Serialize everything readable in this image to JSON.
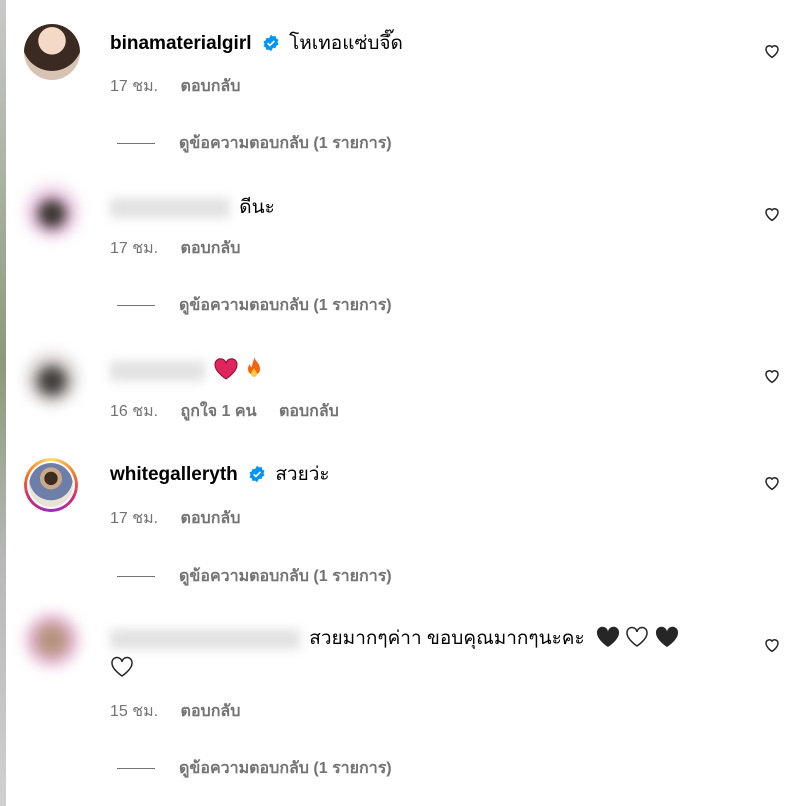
{
  "comments": [
    {
      "username": "binamaterialgirl",
      "text": "โหเทอแซ่บจึ๊ด",
      "time": "17 ชม.",
      "reply": "ตอบกลับ",
      "view_replies": "ดูข้อความตอบกลับ (1 รายการ)"
    },
    {
      "text": "ดีนะ",
      "time": "17 ชม.",
      "reply": "ตอบกลับ",
      "view_replies": "ดูข้อความตอบกลับ (1 รายการ)"
    },
    {
      "time": "16 ชม.",
      "likes": "ถูกใจ 1 คน",
      "reply": "ตอบกลับ"
    },
    {
      "username": "whitegalleryth",
      "text": "สวยว่ะ",
      "time": "17 ชม.",
      "reply": "ตอบกลับ",
      "view_replies": "ดูข้อความตอบกลับ (1 รายการ)"
    },
    {
      "text": "สวยมากๆค่าา ขอบคุณมากๆนะคะ",
      "time": "15 ชม.",
      "reply": "ตอบกลับ",
      "view_replies": "ดูข้อความตอบกลับ (1 รายการ)"
    }
  ],
  "colors": {
    "verified": "#0095f6",
    "muted": "#737373",
    "heart_red": "#e0245e",
    "heart_black": "#262626"
  },
  "icons": [
    "heart-outline-icon",
    "verified-badge-icon",
    "red-heart-emoji",
    "fire-emoji",
    "black-heart-emoji",
    "white-heart-emoji"
  ]
}
